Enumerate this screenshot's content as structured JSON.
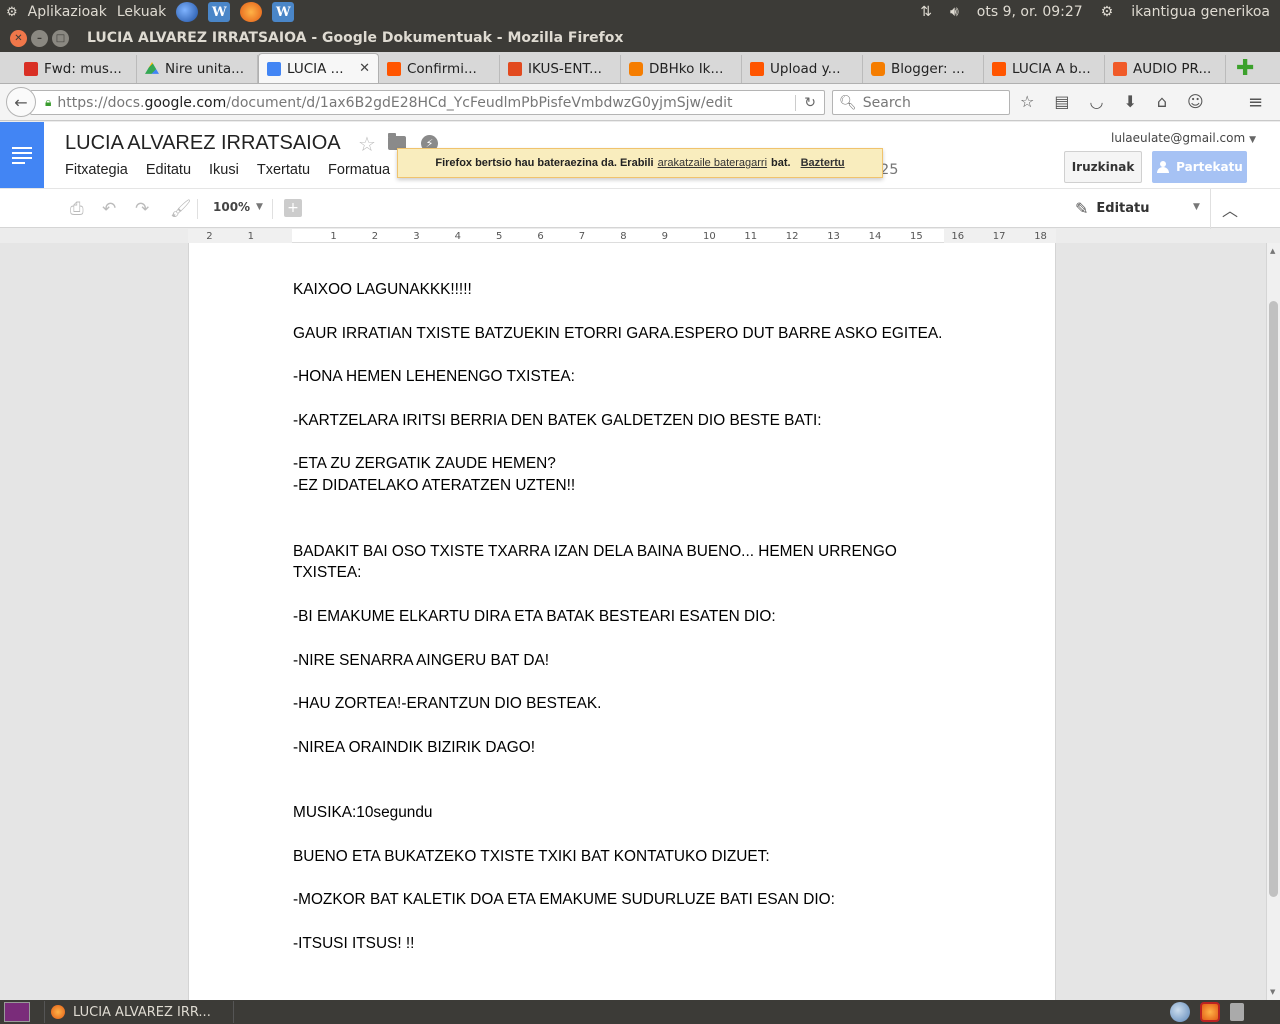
{
  "os_panel": {
    "apps_label": "Aplikazioak",
    "places_label": "Lekuak",
    "datetime": "ots  9, or. 09:27",
    "user": "ikantigua generikoa"
  },
  "window": {
    "title": "LUCIA ALVAREZ IRRATSAIOA - Google Dokumentuak - Mozilla Firefox"
  },
  "tabs": [
    {
      "label": "Fwd: mus...",
      "icon": "gmail-icon"
    },
    {
      "label": "Nire unita...",
      "icon": "drive-icon"
    },
    {
      "label": "LUCIA ...",
      "icon": "docs-icon"
    },
    {
      "label": "Confirmi...",
      "icon": "soundcloud-icon"
    },
    {
      "label": "IKUS-ENT...",
      "icon": "red-icon"
    },
    {
      "label": "DBHko Ik...",
      "icon": "blogger-icon"
    },
    {
      "label": "Upload y...",
      "icon": "soundcloud-icon"
    },
    {
      "label": "Blogger: ...",
      "icon": "blogger-icon"
    },
    {
      "label": "LUCIA A b...",
      "icon": "soundcloud-icon"
    },
    {
      "label": "AUDIO PR...",
      "icon": "red-icon"
    }
  ],
  "tab_close_glyph": "✕",
  "new_tab_glyph": "✚",
  "navbar": {
    "url_host_prefix": "https://docs.",
    "url_host": "google.com",
    "url_path": "/document/d/1ax6B2gdE28HCd_YcFeudlmPbPisfeVmbdwzG0yjmSjw/edit",
    "search_placeholder": "Search"
  },
  "docs": {
    "title": "LUCIA ALVAREZ IRRATSAIOA",
    "menus": [
      "Fitxategia",
      "Editatu",
      "Ikusi",
      "Txertatu",
      "Formatua"
    ],
    "last_edit_fragment": "25",
    "user_email": "lulaeulate@gmail.com",
    "comments_label": "Iruzkinak",
    "share_label": "Partekatu",
    "zoom": "100%",
    "mode_label": "Editatu"
  },
  "ff_banner": {
    "text_before": "Firefox bertsio hau bateraezina da. Erabili",
    "link": "arakatzaile bateragarri",
    "text_after": "bat.",
    "dismiss": "Baztertu"
  },
  "ruler_ticks": [
    "2",
    "1",
    "1",
    "2",
    "3",
    "4",
    "5",
    "6",
    "7",
    "8",
    "9",
    "10",
    "11",
    "12",
    "13",
    "14",
    "15",
    "16",
    "17",
    "18"
  ],
  "document": {
    "paragraphs": [
      "KAIXOO LAGUNAKKK!!!!!",
      "",
      "GAUR IRRATIAN TXISTE BATZUEKIN ETORRI GARA.ESPERO DUT BARRE ASKO EGITEA.",
      "",
      "-HONA HEMEN LEHENENGO TXISTEA:",
      "",
      "-KARTZELARA IRITSI BERRIA DEN BATEK GALDETZEN DIO BESTE BATI:",
      "",
      "-ETA ZU ZERGATIK ZAUDE HEMEN?",
      "-EZ DIDATELAKO ATERATZEN UZTEN!!",
      "",
      "",
      "BADAKIT BAI OSO TXISTE TXARRA IZAN DELA BAINA  BUENO... HEMEN URRENGO TXISTEA:",
      "",
      "-BI EMAKUME ELKARTU DIRA ETA BATAK BESTEARI ESATEN DIO:",
      "",
      "-NIRE SENARRA AINGERU BAT DA!",
      "",
      "-HAU ZORTEA!-ERANTZUN DIO BESTEAK.",
      "",
      "-NIREA ORAINDIK BIZIRIK DAGO!",
      "",
      "",
      "MUSIKA:10segundu",
      "",
      "BUENO ETA BUKATZEKO TXISTE TXIKI BAT KONTATUKO DIZUET:",
      "",
      "-MOZKOR BAT KALETIK DOA ETA EMAKUME SUDURLUZE BATI ESAN DIO:",
      "",
      "-ITSUSI ITSUS! !!"
    ]
  },
  "taskbar": {
    "window_label": "LUCIA ALVAREZ IRR..."
  },
  "colors": {
    "docs_blue": "#4285f4",
    "ubuntu_panel": "#3c3b37",
    "banner_bg": "#f9edbe"
  }
}
